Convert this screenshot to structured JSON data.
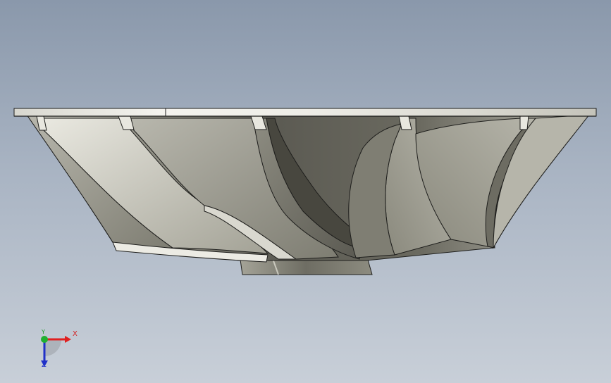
{
  "viewport": {
    "background_top": "#8a98ab",
    "background_bottom": "#c8cfd8"
  },
  "model": {
    "icon": "impeller-3d-model",
    "surface_color": "#8d8c80",
    "highlight_color": "#e4e3dc",
    "edge_color": "#1e1e1c"
  },
  "triad": {
    "x_label": "X",
    "y_label": "Y",
    "z_label": "Z",
    "x_color": "#e02020",
    "y_color": "#20b030",
    "z_color": "#2030c8"
  }
}
